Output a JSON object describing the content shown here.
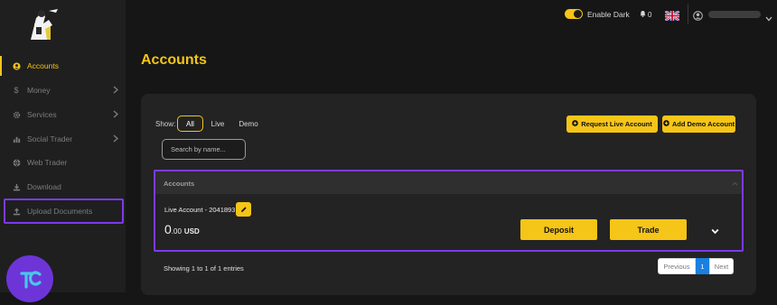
{
  "sidebar": {
    "items": [
      {
        "label": "Accounts",
        "icon": "user-circle-icon"
      },
      {
        "label": "Money",
        "icon": "dollar-icon"
      },
      {
        "label": "Services",
        "icon": "gear-icon"
      },
      {
        "label": "Social Trader",
        "icon": "bar-chart-icon"
      },
      {
        "label": "Web Trader",
        "icon": "globe-icon"
      },
      {
        "label": "Download",
        "icon": "download-icon"
      },
      {
        "label": "Upload Documents",
        "icon": "upload-icon"
      }
    ]
  },
  "header": {
    "toggle_label": "Enable Dark",
    "notifications_count": "0"
  },
  "page": {
    "title": "Accounts"
  },
  "filters": {
    "show_label": "Show:",
    "options": [
      "All",
      "Live",
      "Demo"
    ],
    "selected": "All"
  },
  "actions": {
    "request_live": "Request Live Account",
    "add_demo": "Add Demo Account"
  },
  "search": {
    "placeholder": "Search by name..."
  },
  "accounts_table": {
    "header": "Accounts",
    "rows": [
      {
        "name": "Live Account - 2041893",
        "balance_int": "0",
        "balance_dec": ".00",
        "currency": "USD",
        "deposit_label": "Deposit",
        "trade_label": "Trade"
      }
    ]
  },
  "footer": {
    "entries_text": "Showing 1 to 1 of 1 entries",
    "pagination": {
      "prev": "Previous",
      "current": "1",
      "next": "Next"
    }
  },
  "colors": {
    "accent": "#f5c518",
    "highlight": "#7c3aed",
    "page_link_active": "#1a7fe0"
  }
}
